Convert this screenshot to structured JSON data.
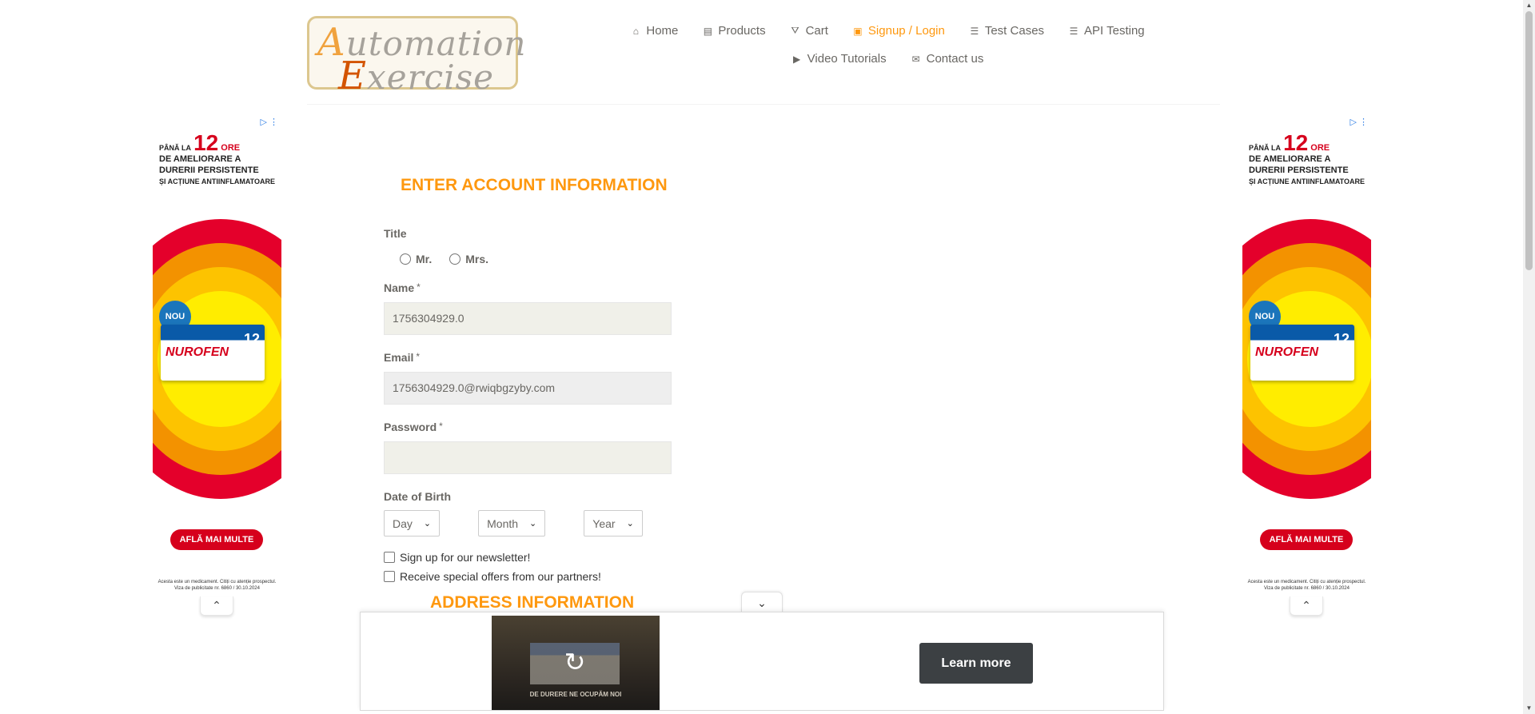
{
  "logo": {
    "line1_cap": "A",
    "line1_rest": "utomation",
    "line2_cap": "E",
    "line2_rest": "xercise"
  },
  "nav": {
    "row1": [
      {
        "label": "Home",
        "icon": "home-icon"
      },
      {
        "label": "Products",
        "icon": "products-icon"
      },
      {
        "label": "Cart",
        "icon": "cart-icon"
      },
      {
        "label": "Signup / Login",
        "icon": "lock-icon",
        "active": true
      },
      {
        "label": "Test Cases",
        "icon": "list-icon"
      },
      {
        "label": "API Testing",
        "icon": "list-icon"
      }
    ],
    "row2": [
      {
        "label": "Video Tutorials",
        "icon": "youtube-icon"
      },
      {
        "label": "Contact us",
        "icon": "envelope-icon"
      }
    ]
  },
  "side_ad": {
    "headline_pre": "PÂNĂ LA",
    "headline_num": "12",
    "headline_unit": "ORE",
    "headline_line2": "DE AMELIORARE A",
    "headline_line3": "DURERII PERSISTENTE",
    "headline_line4": "ȘI ACȚIUNE ANTIINFLAMATOARE",
    "badge": "NOU",
    "brand": "NUROFEN",
    "pack_num": "12",
    "cta": "AFLĂ MAI MULTE",
    "footnote": "Acesta este un medicament. Citiți cu atenție prospectul. Viza de publicitate nr. 6860 / 30.10.2024"
  },
  "form": {
    "section_title": "ENTER ACCOUNT INFORMATION",
    "title_label": "Title",
    "title_options": [
      "Mr.",
      "Mrs."
    ],
    "name_label": "Name",
    "name_value": "1756304929.0",
    "email_label": "Email",
    "email_value": "1756304929.0@rwiqbgzyby.com",
    "password_label": "Password",
    "password_value": "",
    "required_mark": "*",
    "dob_label": "Date of Birth",
    "dob_day": "Day",
    "dob_month": "Month",
    "dob_year": "Year",
    "newsletter_label": "Sign up for our newsletter!",
    "offers_label": "Receive special offers from our partners!",
    "address_title": "ADDRESS INFORMATION"
  },
  "bottom_ad": {
    "video_caption": "DE DURERE NE OCUPĂM NOI",
    "learn_more": "Learn more"
  },
  "colors": {
    "accent": "#fe980f",
    "input_bg": "#f0f0e9",
    "ad_red": "#d6001c"
  }
}
